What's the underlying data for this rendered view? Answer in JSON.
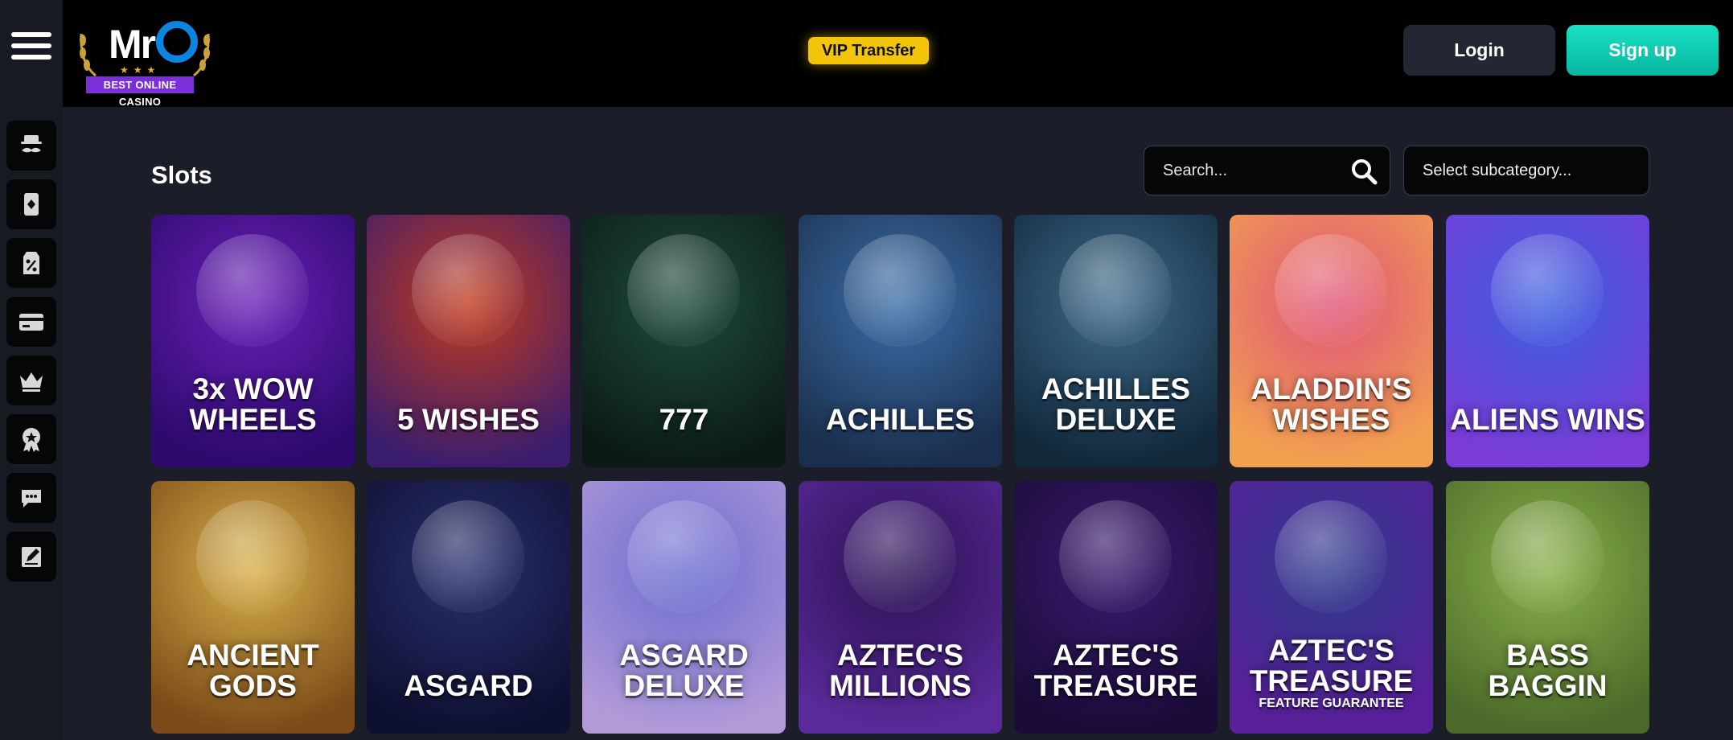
{
  "header": {
    "logo": {
      "name": "MrO",
      "tagline": "BEST ONLINE CASINO"
    },
    "vip_label": "VIP Transfer",
    "login_label": "Login",
    "signup_label": "Sign up"
  },
  "sidebar": {
    "items": [
      {
        "icon": "mustache-hat-icon"
      },
      {
        "icon": "playing-card-icon"
      },
      {
        "icon": "discount-tag-icon"
      },
      {
        "icon": "credit-card-icon"
      },
      {
        "icon": "crown-icon"
      },
      {
        "icon": "award-badge-icon"
      },
      {
        "icon": "chat-support-icon"
      },
      {
        "icon": "edit-note-icon"
      }
    ]
  },
  "main": {
    "section_title": "Slots",
    "search_placeholder": "Search...",
    "subcategory_label": "Select subcategory..."
  },
  "games": [
    {
      "title": "3x WOW WHEELS",
      "bg": "#6a1fb8",
      "bg2": "#2b0a6b"
    },
    {
      "title": "5 WISHES",
      "bg": "#c23a1d",
      "bg2": "#3b1d6e"
    },
    {
      "title": "777",
      "bg": "#1f4b3c",
      "bg2": "#0b1a17"
    },
    {
      "title": "ACHILLES",
      "bg": "#3c6ea8",
      "bg2": "#1a2f4d"
    },
    {
      "title": "ACHILLES DELUXE",
      "bg": "#3f6b8a",
      "bg2": "#11283b"
    },
    {
      "title": "ALADDIN'S WISHES",
      "bg": "#e0547a",
      "bg2": "#f2a24f"
    },
    {
      "title": "ALIENS WINS",
      "bg": "#3a5fe0",
      "bg2": "#7a3bd6"
    },
    {
      "title": "ANCIENT GODS",
      "bg": "#d8b04a",
      "bg2": "#7a4a18"
    },
    {
      "title": "ASGARD",
      "bg": "#2a2f6e",
      "bg2": "#0e1030"
    },
    {
      "title": "ASGARD DELUXE",
      "bg": "#6b6cd1",
      "bg2": "#b29ad8"
    },
    {
      "title": "AZTEC'S MILLIONS",
      "bg": "#2a1252",
      "bg2": "#5a2a9a"
    },
    {
      "title": "AZTEC'S TREASURE",
      "bg": "#3a1a6e",
      "bg2": "#1a0b38"
    },
    {
      "title": "AZTEC'S TREASURE",
      "subtitle": "FEATURE GUARANTEE",
      "bg": "#2e3a8c",
      "bg2": "#5a1f9a"
    },
    {
      "title": "BASS BAGGIN",
      "bg": "#8ab04a",
      "bg2": "#4b6a2a"
    }
  ]
}
